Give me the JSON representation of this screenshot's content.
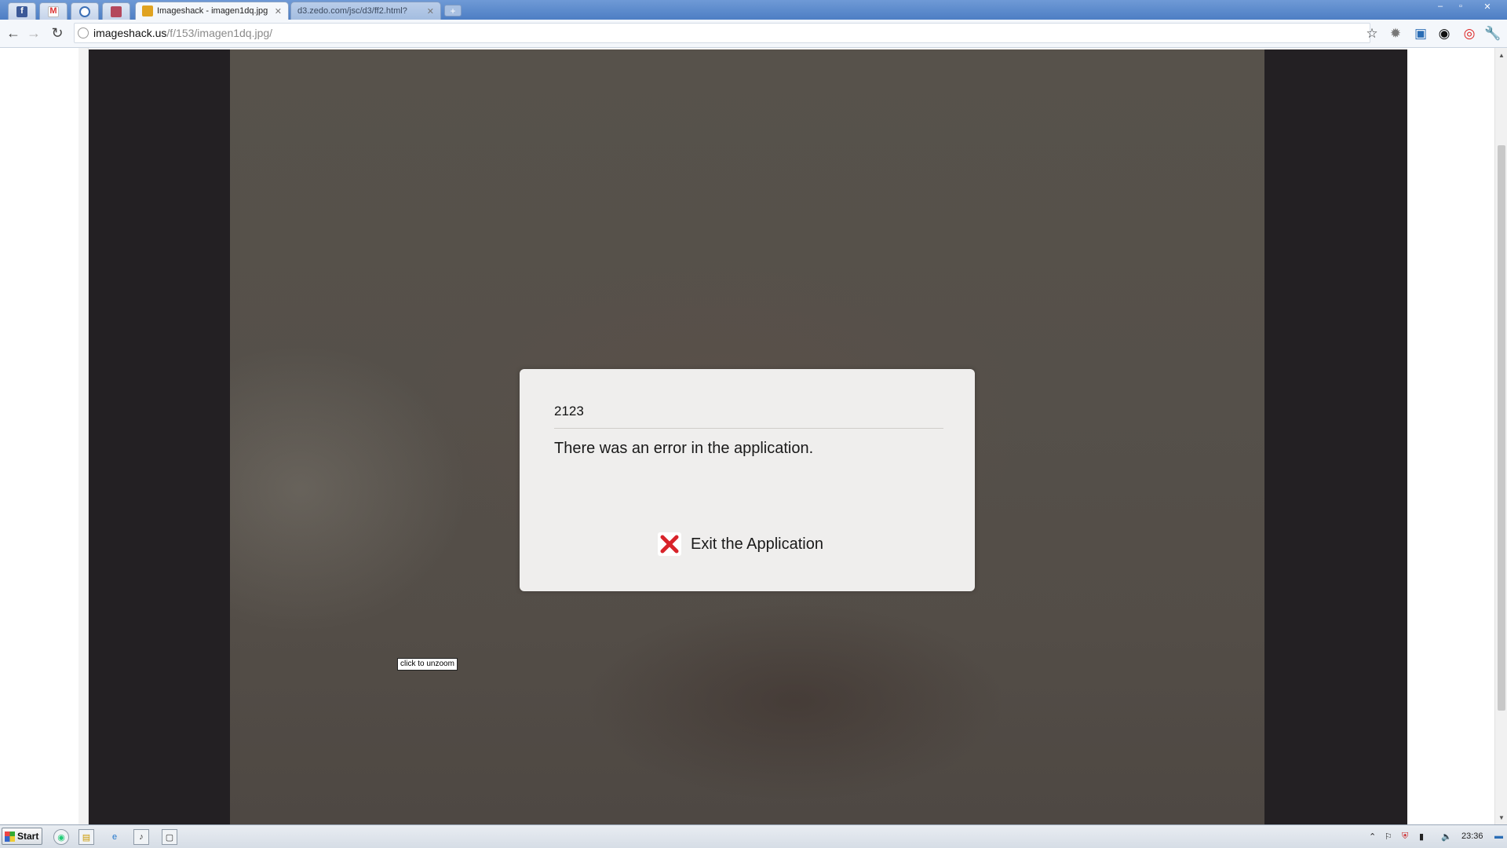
{
  "browser": {
    "tabs": [
      {
        "label": "Imageshack - imagen1dq.jpg",
        "active": true
      },
      {
        "label": "d3.zedo.com/jsc/d3/ff2.html?",
        "active": false
      }
    ],
    "pinned_tabs": [
      "facebook-icon",
      "gmail-icon",
      "extension-icon",
      "bookmark-icon"
    ],
    "url_host": "imageshack.us",
    "url_path": "/f/153/imagen1dq.jpg/",
    "window_controls": {
      "minimize": "–",
      "maximize": "▫",
      "close": "✕"
    },
    "new_tab": "+"
  },
  "page": {
    "tooltip": "click to unzoom"
  },
  "dialog": {
    "code": "2123",
    "message": "There was an error in the application.",
    "exit_label": "Exit the Application",
    "exit_icon": "red-x-icon"
  },
  "taskbar": {
    "start_label": "Start",
    "clock": "23:36"
  },
  "colors": {
    "tabstrip": "#5d8ccc",
    "viewer_bg": "#232023",
    "photo_bg": "#55504a",
    "dialog_bg": "#efeeed",
    "exit_icon": "#d8232a"
  }
}
